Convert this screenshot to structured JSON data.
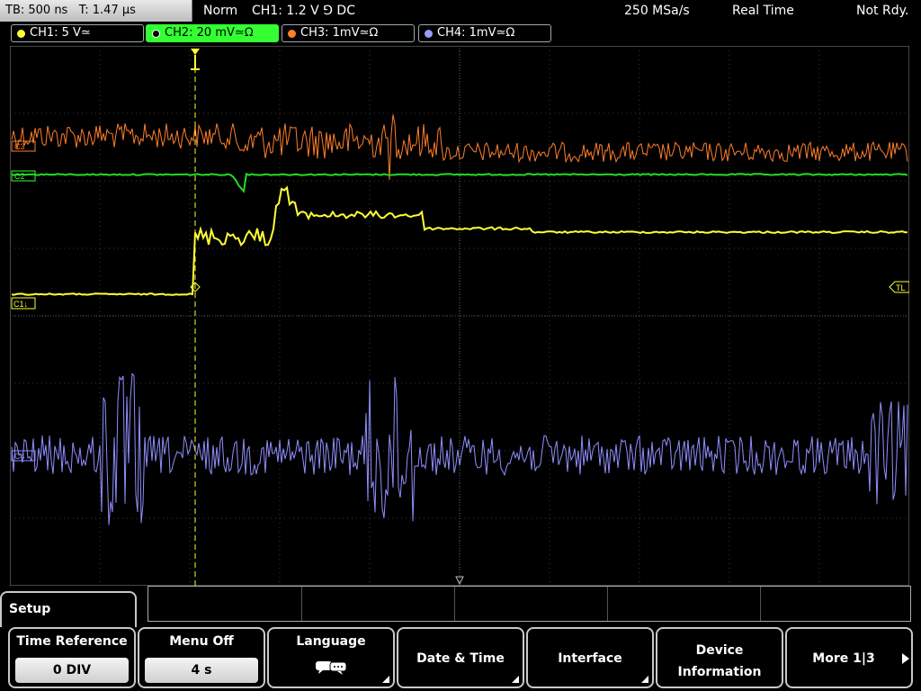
{
  "topbar": {
    "tb": "TB: 500 ns",
    "t": "T: 1.47 µs",
    "mode": "Norm",
    "trigger": "CH1: 1.2 V ⅁ DC",
    "rate": "250 MSa/s",
    "acq": "Real Time",
    "status": "Not Rdy."
  },
  "channels": [
    {
      "label": "CH1: 5 V≃",
      "color": "#ffff33"
    },
    {
      "label": "CH2: 20 mV≃Ω",
      "color": "#33ff33"
    },
    {
      "label": "CH3: 1mV≃Ω",
      "color": "#ff7f2a"
    },
    {
      "label": "CH4: 1mV≃Ω",
      "color": "#9999ff"
    }
  ],
  "markers": {
    "c1": "C1↓",
    "c2": "C2",
    "c3": "C3",
    "c4": "C4",
    "tl": "TL"
  },
  "menu": {
    "title": "Setup",
    "softkeys": [
      {
        "label": "Time Reference",
        "value": "0 DIV"
      },
      {
        "label": "Menu Off",
        "value": "4 s"
      },
      {
        "label": "Language",
        "icon": "speech-bubble-icon"
      },
      {
        "label": "Date & Time"
      },
      {
        "label": "Interface"
      },
      {
        "label_lines": [
          "Device",
          "Information"
        ]
      },
      {
        "label": "More 1|3",
        "icon": "arrow-right-icon"
      }
    ]
  }
}
